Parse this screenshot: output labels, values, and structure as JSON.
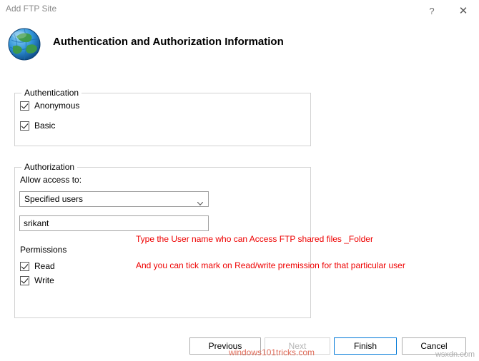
{
  "window": {
    "title": "Add FTP Site",
    "help_label": "?",
    "close_label": "✕"
  },
  "header": {
    "title": "Authentication and Authorization Information",
    "icon": "globe-icon"
  },
  "authentication": {
    "legend": "Authentication",
    "options": [
      {
        "label": "Anonymous",
        "checked": true
      },
      {
        "label": "Basic",
        "checked": true
      }
    ]
  },
  "authorization": {
    "legend": "Authorization",
    "allow_access_label": "Allow access to:",
    "access_select_value": "Specified users",
    "user_field_value": "srikant",
    "user_field_placeholder": "",
    "permissions_label": "Permissions",
    "permissions": [
      {
        "label": "Read",
        "checked": true
      },
      {
        "label": "Write",
        "checked": true
      }
    ]
  },
  "annotations": [
    "Type the User name who can Access FTP shared files _Folder",
    "And you can tick mark on Read/write premission for that particular user"
  ],
  "footer": {
    "previous_label": "Previous",
    "next_label": "Next",
    "finish_label": "Finish",
    "cancel_label": "Cancel"
  },
  "watermarks": {
    "center": "windows101tricks.com",
    "corner": "wsxdn.com"
  },
  "colors": {
    "annotation": "#ee0000",
    "accent": "#0078d7",
    "title_text": "#8a8a8a",
    "watermark_center": "#e06d5a"
  }
}
